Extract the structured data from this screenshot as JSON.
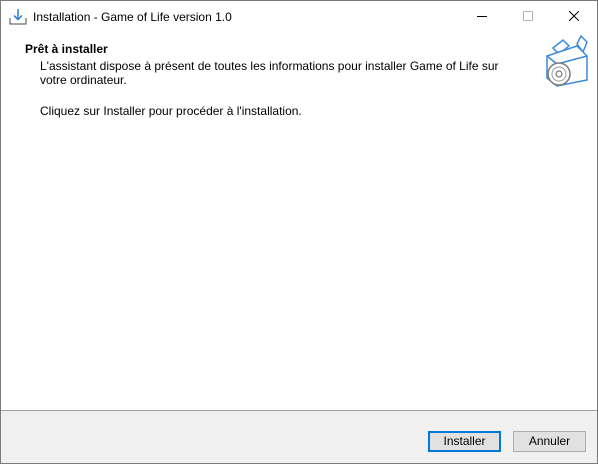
{
  "window": {
    "title": "Installation - Game of Life version 1.0",
    "icons": [
      "installer-download-icon",
      "minimize-icon",
      "maximize-icon",
      "close-icon"
    ]
  },
  "header": {
    "title": "Prêt à installer",
    "subtitle": "L'assistant dispose à présent de toutes les informations pour installer Game of Life sur votre ordinateur.",
    "image": "installer-box-disc-icon"
  },
  "content": {
    "text": "Cliquez sur Installer pour procéder à l'installation."
  },
  "buttons": {
    "install": "Installer",
    "cancel": "Annuler"
  },
  "colors": {
    "accent": "#0078d7",
    "button_bg": "#e1e1e1",
    "footer_bg": "#f0f0f0"
  }
}
